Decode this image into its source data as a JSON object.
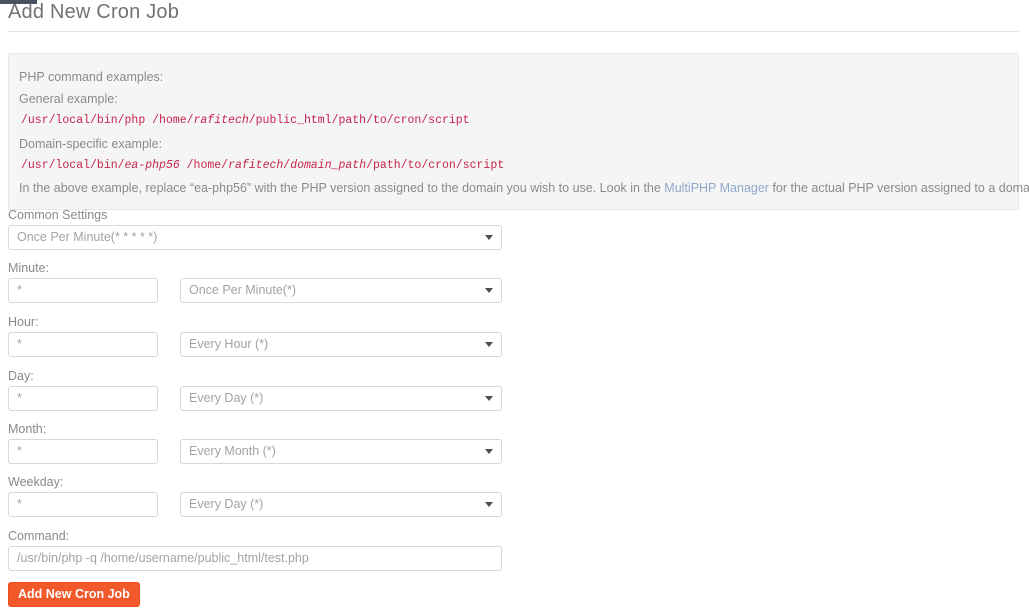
{
  "page": {
    "title": "Add New Cron Job"
  },
  "info_box": {
    "heading": "PHP command examples:",
    "general_label": "General example:",
    "general_code": {
      "prefix": "/usr/local/bin/php  /home/",
      "var1": "rafitech",
      "middle": "/public_html/path/to/cron/script"
    },
    "domain_label": "Domain-specific example:",
    "domain_code": {
      "prefix": "/usr/local/bin/",
      "var1": "ea-php56",
      "middle": "  /home/",
      "var2": "rafitech",
      "sep": "/",
      "var3": "domain_path",
      "suffix": "/path/to/cron/script"
    },
    "note_before": "In the above example, replace “ea-php56” with the PHP version assigned to the domain you wish to use. Look in the ",
    "note_link": "MultiPHP Manager",
    "note_after": " for the actual PHP version assigned to a domain."
  },
  "form": {
    "common_settings": {
      "label": "Common Settings",
      "value": "Once Per Minute(* * * * *)"
    },
    "rows": [
      {
        "label": "Minute:",
        "input_value": "*",
        "select_value": "Once Per Minute(*)"
      },
      {
        "label": "Hour:",
        "input_value": "*",
        "select_value": "Every Hour (*)"
      },
      {
        "label": "Day:",
        "input_value": "*",
        "select_value": "Every Day (*)"
      },
      {
        "label": "Month:",
        "input_value": "*",
        "select_value": "Every Month (*)"
      },
      {
        "label": "Weekday:",
        "input_value": "*",
        "select_value": "Every Day (*)"
      }
    ],
    "command": {
      "label": "Command:",
      "placeholder": "/usr/bin/php -q /home/username/public_html/test.php",
      "value": ""
    },
    "submit_label": "Add New Cron Job"
  },
  "icons": {
    "caret": "chevron-down-icon"
  },
  "colors": {
    "accent": "#f1592a",
    "code_text": "#c7254e",
    "link": "#8fa9cb",
    "panel_bg": "#f5f5f5"
  }
}
